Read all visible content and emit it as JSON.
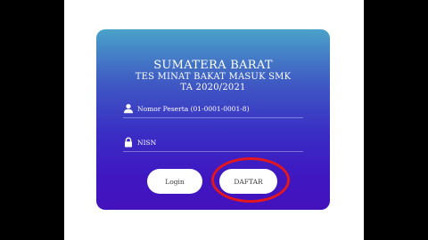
{
  "card": {
    "title_line1": "SUMATERA BARAT",
    "title_line2": "TES MINAT BAKAT MASUK SMK",
    "title_line3": "TA 2020/2021"
  },
  "form": {
    "participant_placeholder": "Nomor Peserta (01-0001-0001-8)",
    "nisn_placeholder": "NISN",
    "participant_icon": "user-icon",
    "nisn_icon": "lock-icon"
  },
  "buttons": {
    "login_label": "Login",
    "register_label": "DAFTAR"
  },
  "colors": {
    "card_gradient_top": "#4aa2c9",
    "card_gradient_bottom": "#4412bd",
    "highlight": "#e4161e"
  }
}
